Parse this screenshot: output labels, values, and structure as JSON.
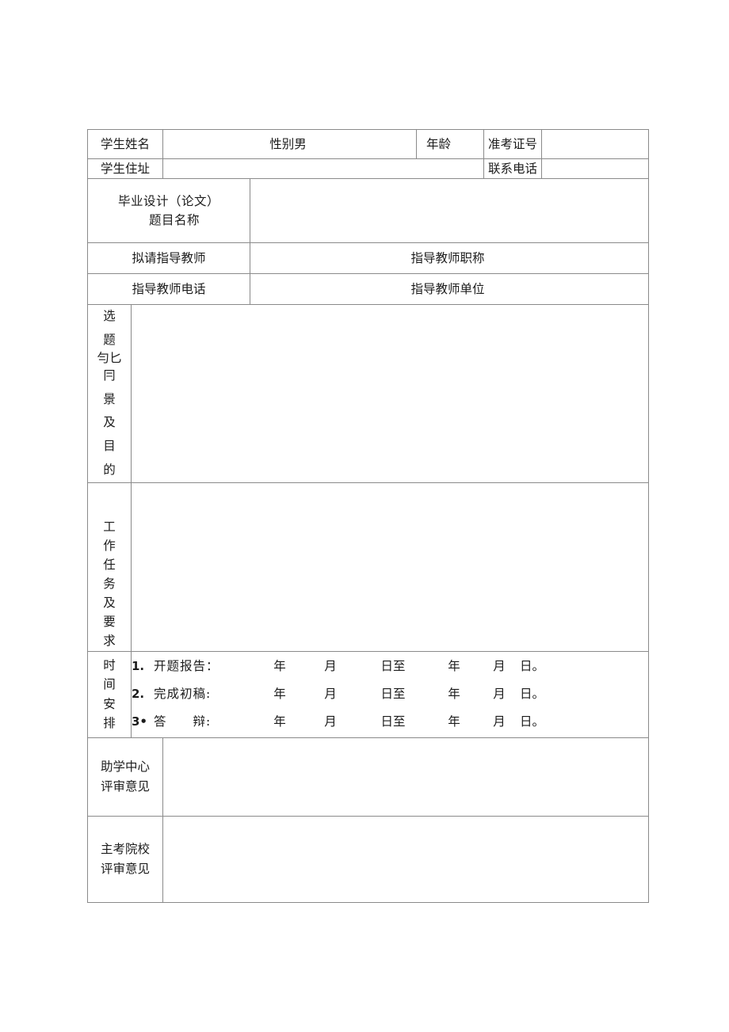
{
  "document": {
    "type": "form",
    "language": "zh-CN"
  },
  "form": {
    "row_student_name": {
      "label": "学生姓名",
      "gender_label": "性别男",
      "age_label": "年龄",
      "exam_no_label": "准考证号",
      "exam_no_value": ""
    },
    "row_student_address": {
      "label": "学生住址",
      "address_value": "",
      "phone_label": "联系电话",
      "phone_value": ""
    },
    "row_thesis_title": {
      "label_line1": "毕业设计（论文）",
      "label_line2": "题目名称",
      "value": ""
    },
    "row_advisor": {
      "label": "拟请指导教师",
      "title_label": "指导教师职称"
    },
    "row_advisor_contact": {
      "label": "指导教师电话",
      "unit_label": "指导教师单位"
    },
    "section_background": {
      "label_chars": [
        "选",
        "题",
        "勻匕",
        "冃",
        "景",
        "及",
        "目",
        "的"
      ],
      "label_plain": "选题背景及目的",
      "value": ""
    },
    "section_task": {
      "label_line1": "工 作",
      "label_line2": "任 务",
      "label_line3": "及 要",
      "label_line4": "求",
      "label_plain": "工作任务及要求",
      "value": ""
    },
    "section_schedule": {
      "label_line1": "时 间",
      "label_line2": "安 排",
      "label_plain": "时间安排",
      "items": [
        {
          "index": "1.",
          "name": "开题报告：",
          "year1": "年",
          "month1": "月",
          "day1": "日至",
          "year2": "年",
          "month2": "月",
          "day2": "日。"
        },
        {
          "index": "2.",
          "name": "完成初稿:",
          "year1": "年",
          "month1": "月",
          "day1": "日至",
          "year2": "年",
          "month2": "月",
          "day2": "日。"
        },
        {
          "index": "3•",
          "name": "答　　辩:",
          "year1": "年",
          "month1": "月",
          "day1": "日至",
          "year2": "年",
          "month2": "月",
          "day2": "日。"
        }
      ]
    },
    "section_center_review": {
      "label_line1": "助学中心",
      "label_line2": "评审意见",
      "value": ""
    },
    "section_school_review": {
      "label_line1": "主考院校",
      "label_line2": "评审意见",
      "value": ""
    }
  },
  "colors": {
    "border": "#8a8a8a",
    "text": "#1c1c1c",
    "background": "#ffffff"
  }
}
